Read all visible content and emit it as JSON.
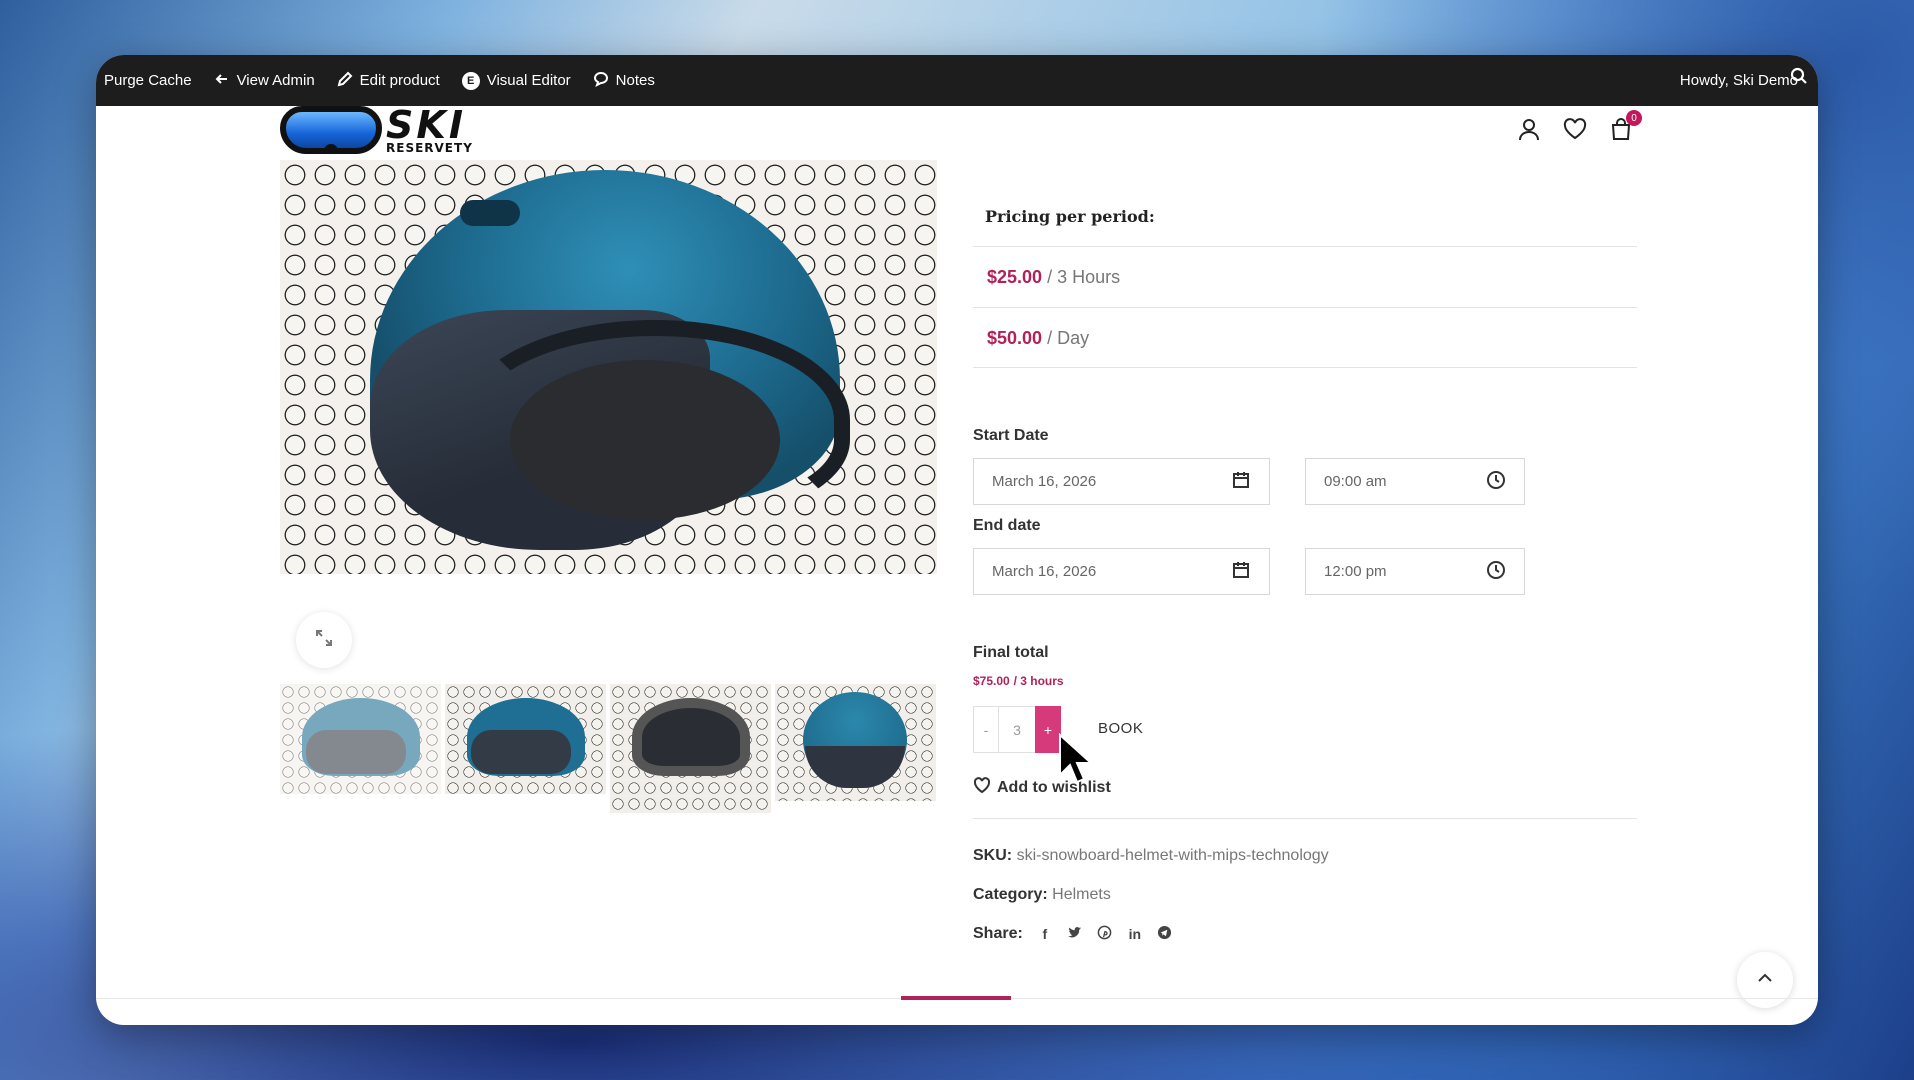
{
  "adminbar": {
    "purge_cache": "Purge Cache",
    "view_admin": "View Admin",
    "edit_product": "Edit product",
    "visual_editor": "Visual Editor",
    "notes": "Notes",
    "howdy": "Howdy, Ski Demo"
  },
  "logo": {
    "main": "SKI",
    "sub": "RESERVETY"
  },
  "header": {
    "cart_count": "0"
  },
  "pricing": {
    "title": "Pricing per period:",
    "rows": [
      {
        "amount": "$25.00",
        "period": "/ 3 Hours"
      },
      {
        "amount": "$50.00",
        "period": "/ Day"
      }
    ]
  },
  "booking": {
    "start_label": "Start Date",
    "start_date": "March 16, 2026",
    "start_time": "09:00 am",
    "end_label": "End date",
    "end_date": "March 16, 2026",
    "end_time": "12:00 pm",
    "final_label": "Final total",
    "final_amount": "$75.00",
    "final_period": "/ 3 hours",
    "qty_minus": "-",
    "qty_value": "3",
    "qty_plus": "+",
    "book_label": "BOOK",
    "wishlist_label": "Add to wishlist"
  },
  "meta": {
    "sku_label": "SKU:",
    "sku_value": "ski-snowboard-helmet-with-mips-technology",
    "category_label": "Category:",
    "category_value": "Helmets",
    "share_label": "Share:"
  },
  "share_icons": [
    "f",
    "t",
    "p",
    "in",
    "tg"
  ],
  "colors": {
    "accent": "#b0225a",
    "plus_button": "#d63a7b",
    "admin_bar": "#1d1d1d"
  }
}
